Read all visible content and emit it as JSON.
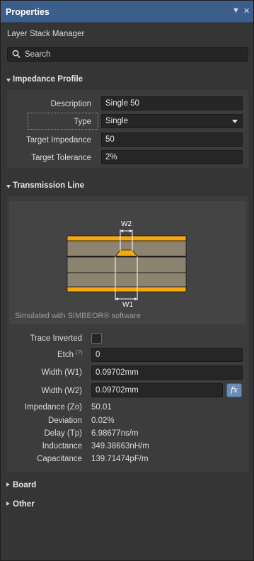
{
  "panel": {
    "title": "Properties",
    "subtitle": "Layer Stack Manager",
    "search_placeholder": "Search"
  },
  "impedance_profile": {
    "header": "Impedance Profile",
    "description_label": "Description",
    "description_value": "Single 50",
    "type_label": "Type",
    "type_value": "Single",
    "target_impedance_label": "Target Impedance",
    "target_impedance_value": "50",
    "target_tolerance_label": "Target Tolerance",
    "target_tolerance_value": "2%"
  },
  "transmission_line": {
    "header": "Transmission Line",
    "diagram": {
      "w2_label": "W2",
      "w1_label": "W1",
      "simulated_text": "Simulated with SIMBEOR® software"
    },
    "trace_inverted_label": "Trace Inverted",
    "trace_inverted_checked": false,
    "etch_label": "Etch",
    "etch_help": "(?)",
    "etch_value": "0",
    "width_w1_label": "Width (W1)",
    "width_w1_value": "0.09702mm",
    "width_w2_label": "Width (W2)",
    "width_w2_value": "0.09702mm",
    "fx_label": "fx",
    "results": [
      {
        "label": "Impedance (Zo)",
        "value": "50.01"
      },
      {
        "label": "Deviation",
        "value": "0.02%"
      },
      {
        "label": "Delay (Tp)",
        "value": "6.98677ns/m"
      },
      {
        "label": "Inductance",
        "value": "349.38663nH/m"
      },
      {
        "label": "Capacitance",
        "value": "139.71474pF/m"
      }
    ]
  },
  "board": {
    "header": "Board"
  },
  "other": {
    "header": "Other"
  },
  "colors": {
    "titlebar": "#3c5e8b",
    "copper": "#f5a70f",
    "dielectric": "#8c8470",
    "fx_button": "#6a8db5"
  },
  "icons": {
    "close": "close-icon",
    "pin": "pin-icon",
    "search": "search-icon",
    "dropdown": "chevron-down-icon"
  }
}
